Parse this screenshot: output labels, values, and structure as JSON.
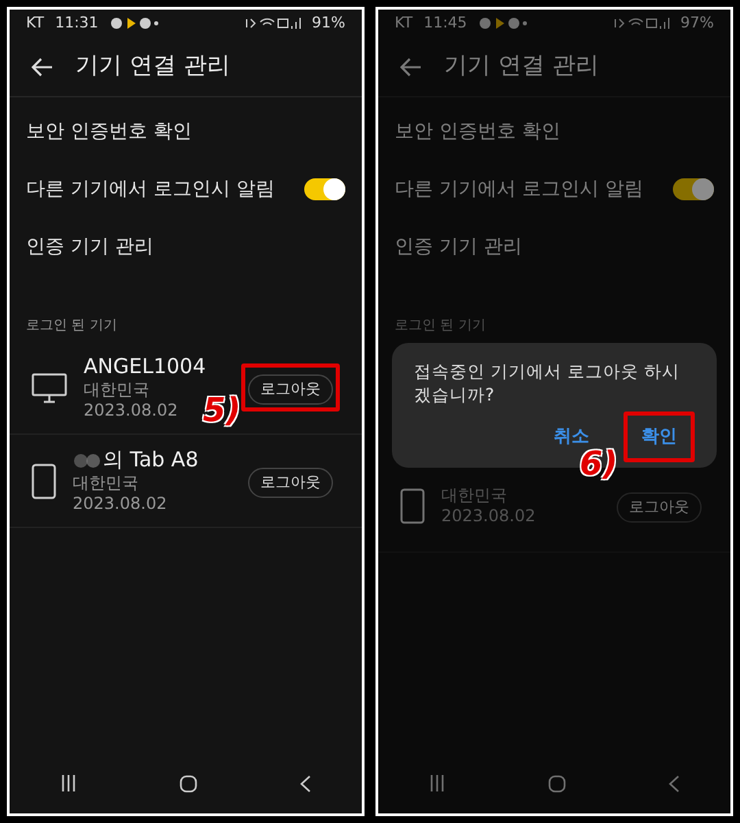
{
  "screens": [
    {
      "status_bar": {
        "carrier": "KT",
        "time": "11:31",
        "battery": "91%"
      },
      "title": "기기 연결 관리",
      "settings": [
        {
          "kind": "link",
          "label": "보안 인증번호 확인"
        },
        {
          "kind": "toggle",
          "label": "다른 기기에서 로그인시 알림",
          "on": true
        },
        {
          "kind": "link",
          "label": "인증 기기 관리"
        }
      ],
      "section_label": "로그인 된 기기",
      "devices": [
        {
          "kind": "desktop",
          "name": "ANGEL1004",
          "country": "대한민국",
          "date": "2023.08.02",
          "logout": "로그아웃",
          "highlighted": true,
          "annotation": "5)"
        },
        {
          "kind": "tablet",
          "name": "의 Tab A8",
          "blurred_prefix": true,
          "country": "대한민국",
          "date": "2023.08.02",
          "logout": "로그아웃",
          "highlighted": false
        }
      ]
    },
    {
      "status_bar": {
        "carrier": "KT",
        "time": "11:45",
        "battery": "97%"
      },
      "title": "기기 연결 관리",
      "dimmed": true,
      "settings": [
        {
          "kind": "link",
          "label": "보안 인증번호 확인"
        },
        {
          "kind": "toggle",
          "label": "다른 기기에서 로그인시 알림",
          "on": true
        },
        {
          "kind": "link",
          "label": "인증 기기 관리"
        }
      ],
      "section_label": "로그인 된 기기",
      "devices": [
        {
          "kind": "tablet",
          "country": "대한민국",
          "date": "2023.08.02",
          "logout": "로그아웃",
          "highlighted": false
        }
      ],
      "dialog": {
        "message": "접속중인 기기에서 로그아웃 하시겠습니까?",
        "buttons": [
          {
            "label": "취소",
            "highlighted": false
          },
          {
            "label": "확인",
            "highlighted": true,
            "annotation": "6)"
          }
        ]
      }
    }
  ]
}
